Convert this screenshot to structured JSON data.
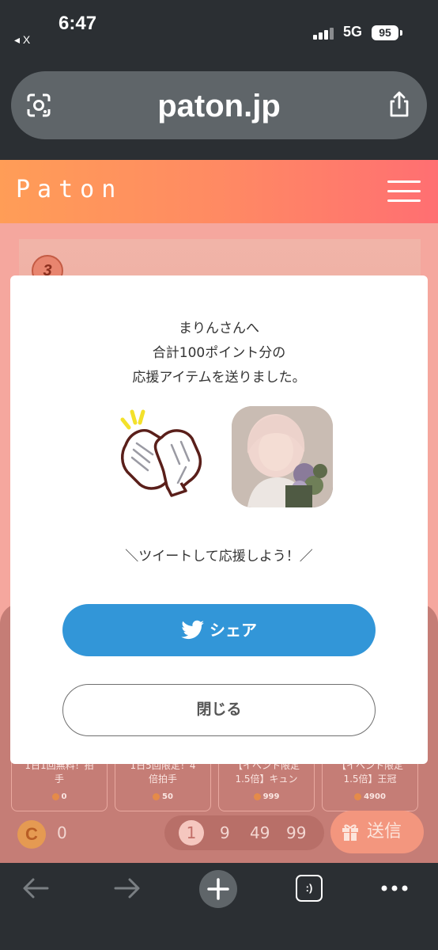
{
  "status": {
    "time": "6:47",
    "back_label": "◂ X",
    "network": "5G",
    "battery": "95"
  },
  "browser": {
    "url": "paton.jp",
    "toolbar": {
      "back": "back-arrow-icon",
      "forward": "forward-arrow-icon",
      "new_tab": "plus-icon",
      "tabs": "tabs-icon",
      "more": "more-icon"
    },
    "tabs_label": ":)"
  },
  "site": {
    "logo": "Paton"
  },
  "page": {
    "rank": "3",
    "items": [
      {
        "name_line1": "1日1回無料！拍",
        "name_line2": "手",
        "cost": "0"
      },
      {
        "name_line1": "1日5回限定！4",
        "name_line2": "倍拍手",
        "cost": "50"
      },
      {
        "name_line1": "【イベント限定",
        "name_line2": "1.5倍】キュン",
        "cost": "999"
      },
      {
        "name_line1": "【イベント限定",
        "name_line2": "1.5倍】王冠",
        "cost": "4900"
      }
    ],
    "coin_symbol": "C",
    "coin_balance": "0",
    "quantities": [
      "1",
      "9",
      "49",
      "99"
    ],
    "send_label": "送信"
  },
  "modal": {
    "line1": "まりんさんへ",
    "line2": "合計100ポイント分の",
    "line3": "応援アイテムを送りました。",
    "cta": "＼ツイートして応援しよう！／",
    "share_label": "シェア",
    "close_label": "閉じる",
    "colors": {
      "share": "#3296d8",
      "header_start": "#ff9d57",
      "header_end": "#ff6f72"
    }
  }
}
